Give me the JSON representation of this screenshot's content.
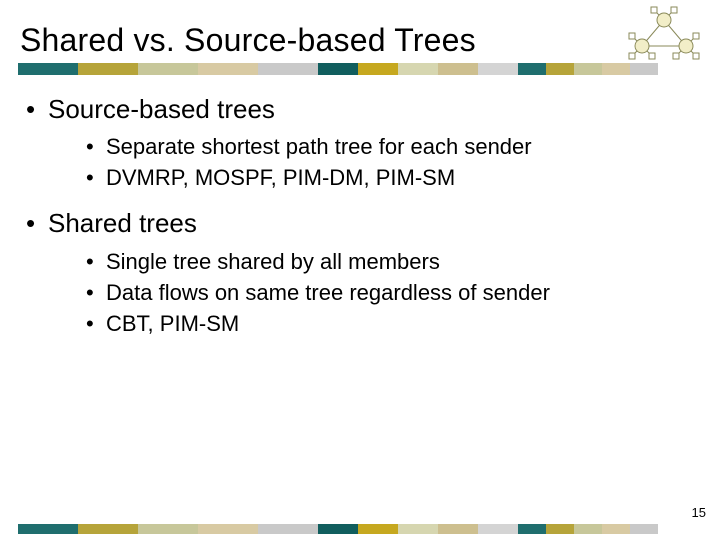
{
  "title": "Shared vs. Source-based Trees",
  "bullets": {
    "b1": "Source-based trees",
    "b1_1": "Separate shortest path tree for each sender",
    "b1_2": "DVMRP, MOSPF, PIM-DM, PIM-SM",
    "b2": "Shared trees",
    "b2_1": "Single tree shared by all members",
    "b2_2": "Data flows on same tree regardless of sender",
    "b2_3": "CBT, PIM-SM"
  },
  "page_number": "15"
}
